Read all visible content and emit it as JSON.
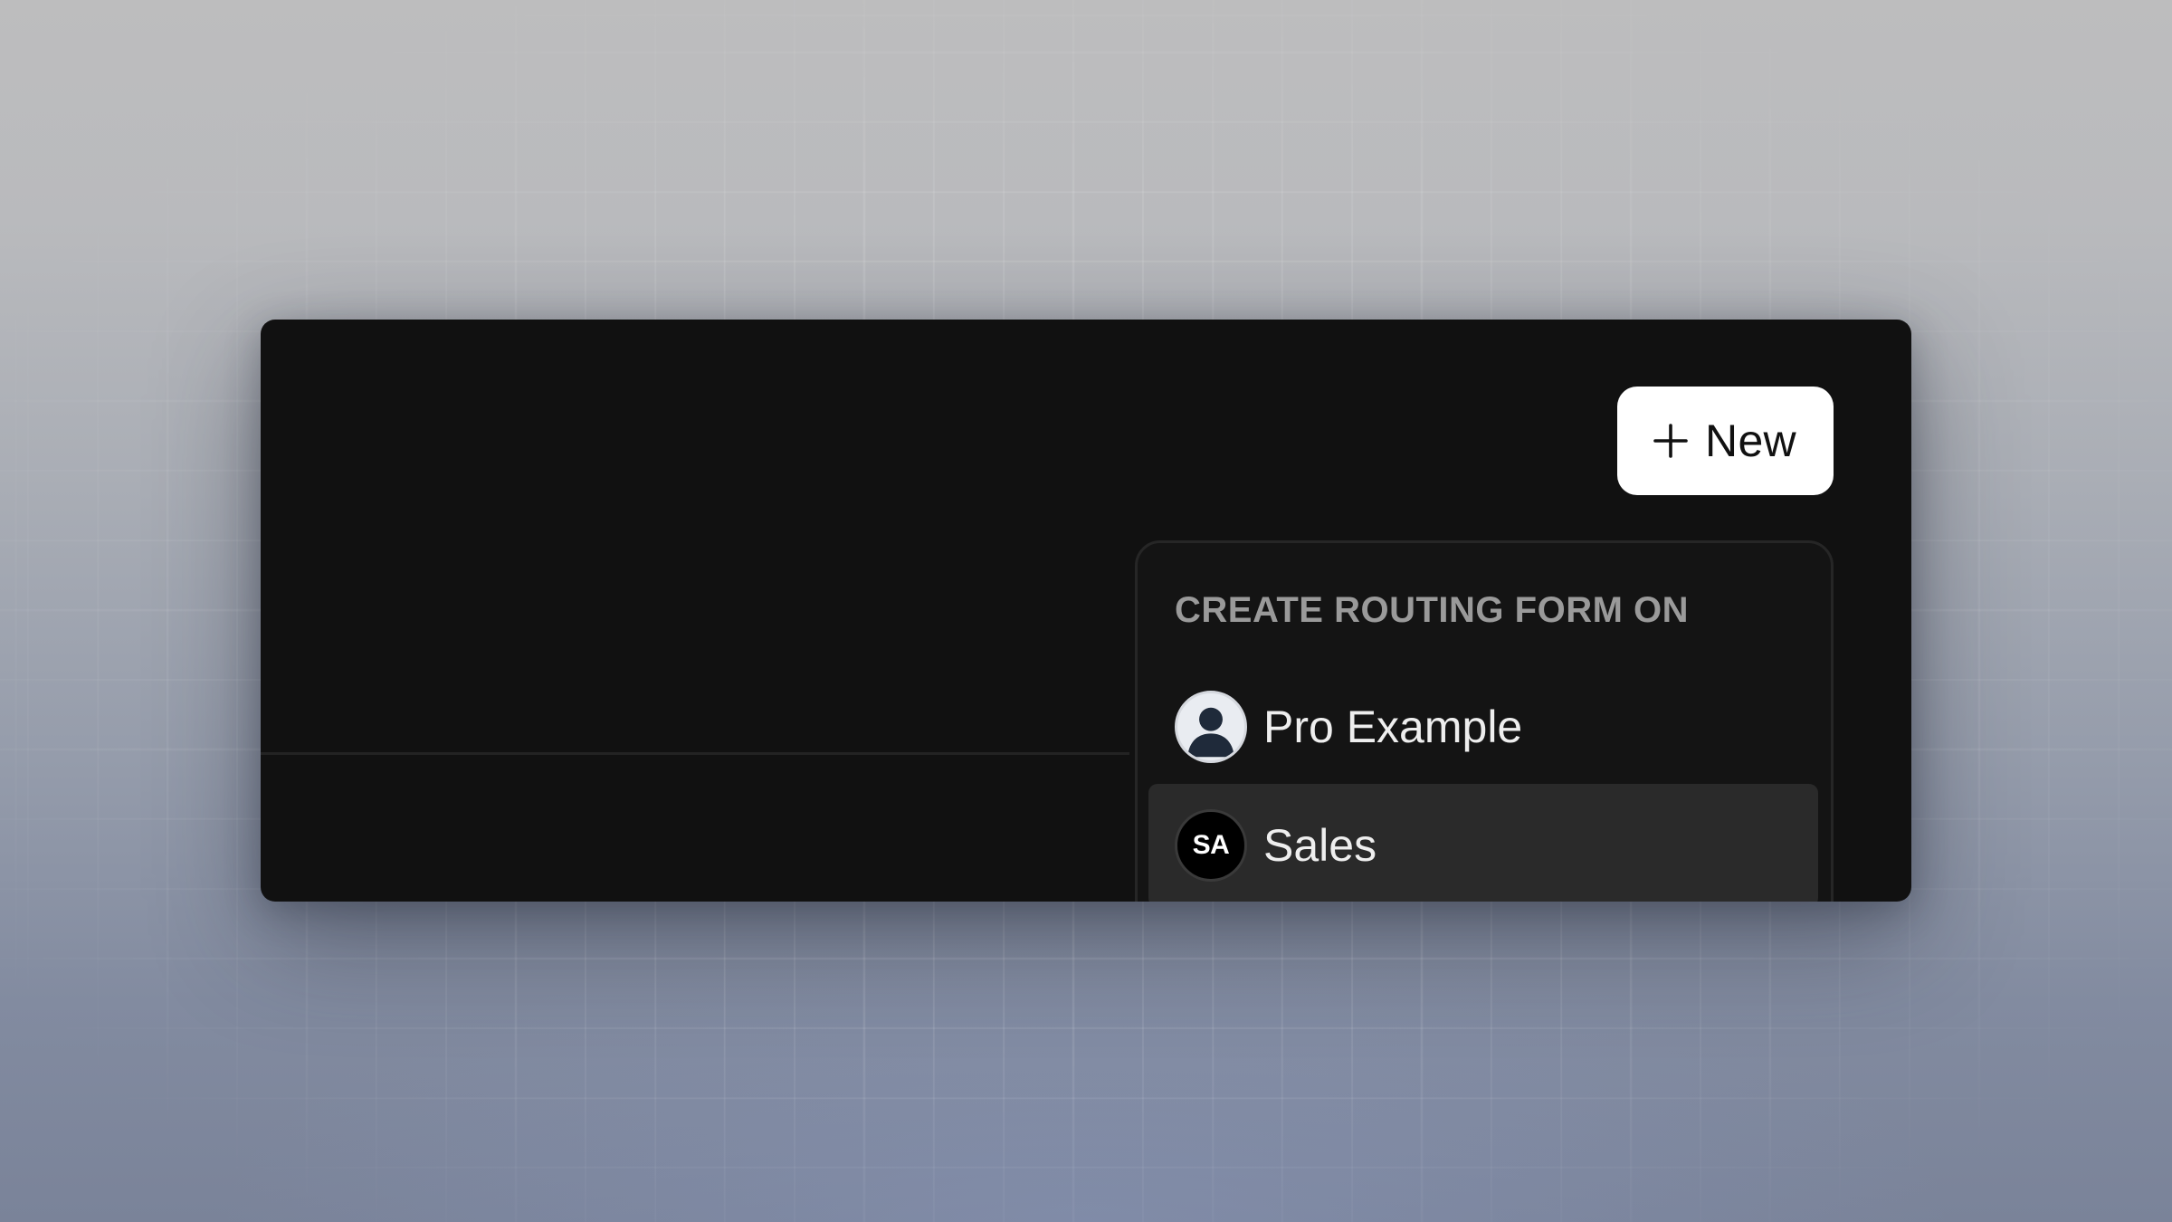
{
  "header": {
    "new_button_label": "New",
    "new_button_icon": "plus-icon"
  },
  "dropdown": {
    "heading": "CREATE ROUTING FORM ON",
    "items": [
      {
        "label": "Pro Example",
        "avatar": "user-avatar-icon",
        "highlighted": false
      },
      {
        "label": "Sales",
        "avatar_initials": "SA",
        "highlighted": true
      }
    ]
  },
  "colors": {
    "panel_background": "#111111",
    "dropdown_background": "#141414",
    "highlight_background": "#2a2a2a",
    "button_background": "#ffffff",
    "heading_text": "#9a9a9a"
  }
}
